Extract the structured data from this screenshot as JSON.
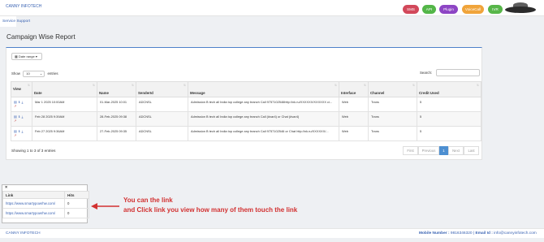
{
  "header": {
    "brand": "CANNY INFOTECH",
    "nav": [
      "SMS",
      "API",
      "Plugin",
      "VoiceCall",
      "IVR"
    ]
  },
  "breadcrumb": "Service Support",
  "page_title": "Campaign Wise Report",
  "filters": {
    "date_range_label": "Date range",
    "show_label": "Show",
    "show_value": "10",
    "entries_label": "entries",
    "search_label": "Search:"
  },
  "table": {
    "headers": [
      "View",
      "Date",
      "Name",
      "SenderId",
      "Message",
      "Interface",
      "Channel",
      "Credit Used"
    ],
    "rows": [
      {
        "date": "Mar 1 2025 10:00AM",
        "name": "01-Mar-2025 10:01",
        "sender": "ADCNSL",
        "message": "Admission B tech all India top college any branch Call 9757102546http://nk.ru/XXXXXX/XXXXXX ci...",
        "interface": "Web",
        "channel": "Trans",
        "credit": "5"
      },
      {
        "date": "Feb 28 2025 9:39AM",
        "name": "28-Feb-2025 09:38",
        "sender": "ADCNSL",
        "message": "Admission B tech all India top college any branch Call (#var4) or Chat (#var4)",
        "interface": "Web",
        "channel": "Trans",
        "credit": "5"
      },
      {
        "date": "Feb 27 2025 9:36AM",
        "name": "27-Feb-2025 09:35",
        "sender": "ADCNSL",
        "message": "Admission B tech all India top college any branch Call 9757102546 or Chat http://nk.ru/XXXXXX/...",
        "interface": "Web",
        "channel": "Trans",
        "credit": "5"
      }
    ]
  },
  "info": "Showing 1 to 3 of 3 entries",
  "pager": {
    "first": "First",
    "previous": "Previous",
    "current": "1",
    "next": "Next",
    "last": "Last"
  },
  "popup": {
    "close": "×",
    "headers": [
      "Link",
      "Hits"
    ],
    "rows": [
      {
        "link": "https://www.smartypowrhw.com/",
        "hits": "0"
      },
      {
        "link": "https://www.smartypowrhw.com/",
        "hits": "0"
      }
    ]
  },
  "annotation": {
    "line1": "You can the link",
    "line2": "and Click link you view how  many of them touch the link"
  },
  "footer": {
    "brand": "CANNY INFOTECH",
    "mobile_label": "Mobile Number :",
    "mobile": "9816346320",
    "email_label": "Email Id :",
    "email": "info@cannyinfotech.com"
  }
}
